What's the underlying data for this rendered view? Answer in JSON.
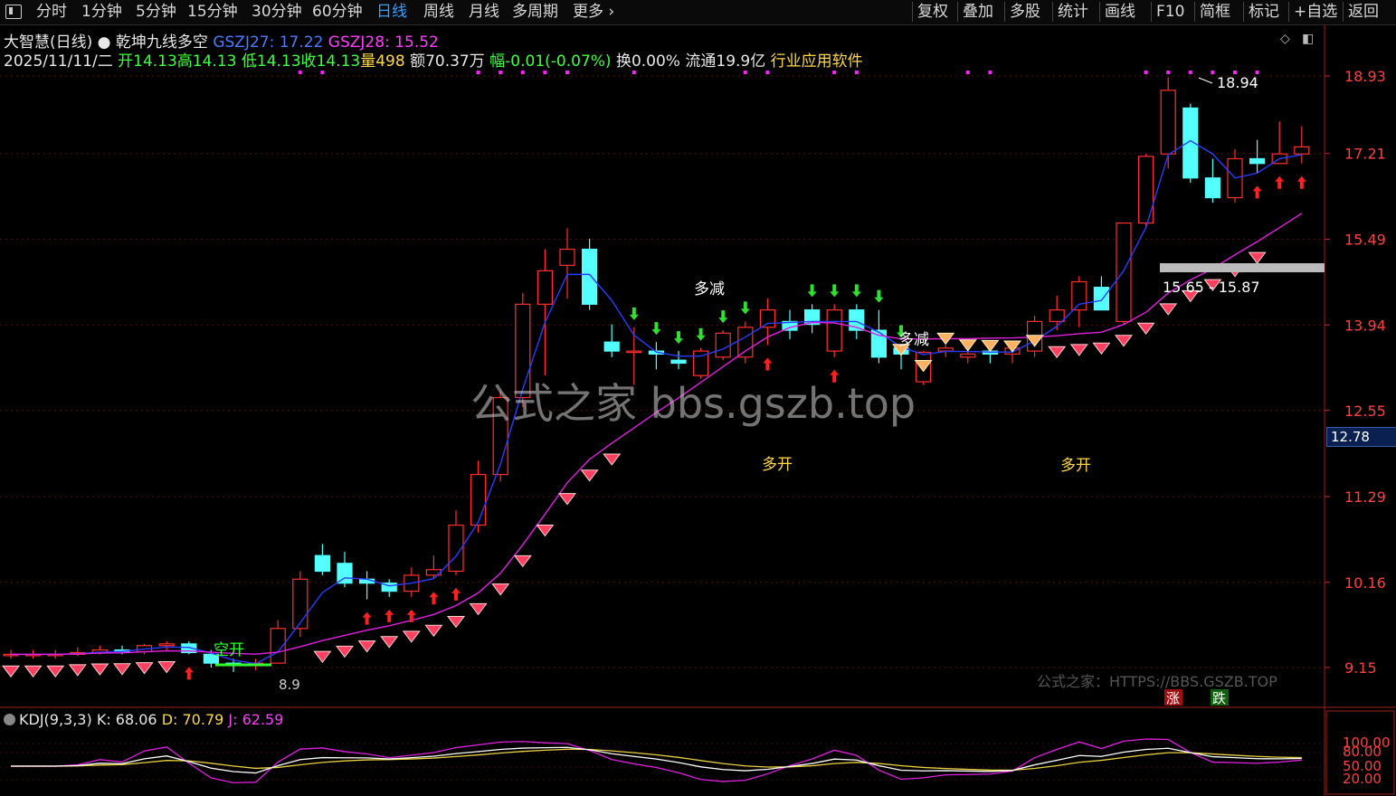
{
  "toolbar": {
    "left": [
      "分时",
      "1分钟",
      "5分钟",
      "15分钟",
      "30分钟",
      "60分钟",
      "日线",
      "周线",
      "月线",
      "多周期",
      "更多"
    ],
    "active": "日线",
    "right": [
      "复权",
      "叠加",
      "多股",
      "统计",
      "画线",
      "F10",
      "简框",
      "标记",
      "+自选",
      "返回"
    ]
  },
  "header": {
    "stock": "大智慧(日线)",
    "indicator": "乾坤九线多空",
    "gs27_label": "GSZJ27: 17.22",
    "gs28_label": "GSZJ28: 15.52",
    "date": "2025/11/11/二",
    "open": "开14.13",
    "high": "高14.13",
    "low": "低14.13",
    "close": "收14.13",
    "volume": "量498",
    "amount": "额70.37万",
    "change": "幅-0.01(-0.07%)",
    "turnover": "换0.00%",
    "float": "流通19.9亿",
    "industry": "行业应用软件"
  },
  "colors": {
    "up": "#ff3030",
    "down": "#54ffff",
    "ma_blue": "#2a3cff",
    "ma_magenta": "#e020e0",
    "buy": "#ff2020",
    "sell": "#30e030"
  },
  "price_axis": [
    {
      "v": "18.93",
      "p": 18.93
    },
    {
      "v": "17.21",
      "p": 17.21
    },
    {
      "v": "15.49",
      "p": 15.49
    },
    {
      "v": "13.94",
      "p": 13.94
    },
    {
      "v": "12.55",
      "p": 12.55
    },
    {
      "v": "11.29",
      "p": 11.29
    },
    {
      "v": "10.16",
      "p": 10.16
    },
    {
      "v": "9.15",
      "p": 9.15
    }
  ],
  "current_price": "12.78",
  "annotations": {
    "high_label": "18.94",
    "zone_label": "15.65 - 15.87",
    "duojian": "多减",
    "duokai": "多开",
    "kongkai": "空开",
    "low_label": "8.9",
    "watermark_big": "公式之家 bbs.gszb.top",
    "watermark_footer": "公式之家：HTTPS://BBS.GSZB.TOP",
    "rise": "涨",
    "fall": "跌"
  },
  "kdj": {
    "name": "KDJ(9,3,3)",
    "k": "K: 68.06",
    "d": "D: 70.79",
    "j": "J: 62.59",
    "axis": [
      "100.00",
      "80.00",
      "50.00",
      "20.00"
    ]
  },
  "chart_data": {
    "type": "candlestick",
    "candles": [
      [
        9.3,
        9.35,
        9.25,
        9.3
      ],
      [
        9.3,
        9.35,
        9.25,
        9.3
      ],
      [
        9.3,
        9.35,
        9.25,
        9.3
      ],
      [
        9.3,
        9.38,
        9.28,
        9.32
      ],
      [
        9.32,
        9.4,
        9.3,
        9.35
      ],
      [
        9.35,
        9.4,
        9.3,
        9.33
      ],
      [
        9.33,
        9.42,
        9.3,
        9.4
      ],
      [
        9.4,
        9.45,
        9.35,
        9.42
      ],
      [
        9.42,
        9.45,
        9.3,
        9.32
      ],
      [
        9.3,
        9.35,
        9.15,
        9.2
      ],
      [
        9.2,
        9.25,
        9.1,
        9.18
      ],
      [
        9.18,
        9.25,
        9.12,
        9.2
      ],
      [
        9.2,
        9.7,
        9.2,
        9.6
      ],
      [
        9.6,
        10.3,
        9.5,
        10.2
      ],
      [
        10.5,
        10.65,
        10.25,
        10.3
      ],
      [
        10.4,
        10.55,
        10.1,
        10.15
      ],
      [
        10.2,
        10.3,
        9.95,
        10.15
      ],
      [
        10.15,
        10.2,
        9.98,
        10.05
      ],
      [
        10.05,
        10.35,
        9.98,
        10.25
      ],
      [
        10.25,
        10.5,
        10.2,
        10.32
      ],
      [
        10.3,
        11.1,
        10.25,
        10.9
      ],
      [
        10.9,
        11.8,
        10.8,
        11.6
      ],
      [
        11.6,
        12.85,
        11.5,
        12.75
      ],
      [
        12.75,
        14.5,
        12.6,
        14.3
      ],
      [
        14.3,
        15.3,
        13.1,
        14.9
      ],
      [
        15.0,
        15.7,
        14.4,
        15.3
      ],
      [
        15.3,
        15.5,
        14.2,
        14.3
      ],
      [
        13.65,
        13.95,
        13.4,
        13.5
      ],
      [
        13.5,
        13.9,
        12.95,
        13.5
      ],
      [
        13.5,
        13.65,
        13.2,
        13.45
      ],
      [
        13.35,
        13.5,
        13.2,
        13.3
      ],
      [
        13.1,
        13.55,
        13.05,
        13.5
      ],
      [
        13.4,
        13.85,
        13.35,
        13.8
      ],
      [
        13.4,
        14.0,
        13.3,
        13.9
      ],
      [
        13.9,
        14.4,
        13.6,
        14.2
      ],
      [
        14.0,
        14.2,
        13.7,
        13.85
      ],
      [
        14.2,
        14.3,
        13.8,
        13.95
      ],
      [
        13.5,
        14.3,
        13.4,
        14.2
      ],
      [
        14.2,
        14.3,
        13.7,
        13.85
      ],
      [
        13.85,
        14.2,
        13.3,
        13.4
      ],
      [
        13.55,
        13.6,
        13.2,
        13.45
      ],
      [
        13.0,
        13.5,
        12.95,
        13.48
      ],
      [
        13.5,
        13.6,
        13.4,
        13.55
      ],
      [
        13.4,
        13.5,
        13.3,
        13.45
      ],
      [
        13.5,
        13.55,
        13.3,
        13.45
      ],
      [
        13.45,
        13.6,
        13.3,
        13.55
      ],
      [
        13.5,
        14.1,
        13.4,
        14.0
      ],
      [
        14.0,
        14.45,
        13.85,
        14.2
      ],
      [
        14.2,
        14.8,
        13.9,
        14.7
      ],
      [
        14.6,
        14.8,
        14.2,
        14.2
      ],
      [
        14.0,
        15.8,
        13.95,
        15.8
      ],
      [
        15.8,
        17.2,
        15.7,
        17.15
      ],
      [
        17.2,
        18.9,
        16.9,
        18.6
      ],
      [
        18.2,
        18.3,
        16.6,
        16.7
      ],
      [
        16.7,
        17.1,
        16.2,
        16.3
      ],
      [
        16.3,
        17.3,
        16.2,
        17.1
      ],
      [
        17.1,
        17.5,
        16.8,
        17.0
      ],
      [
        17.0,
        17.9,
        17.0,
        17.2
      ],
      [
        17.2,
        17.8,
        17.0,
        17.35
      ]
    ]
  }
}
